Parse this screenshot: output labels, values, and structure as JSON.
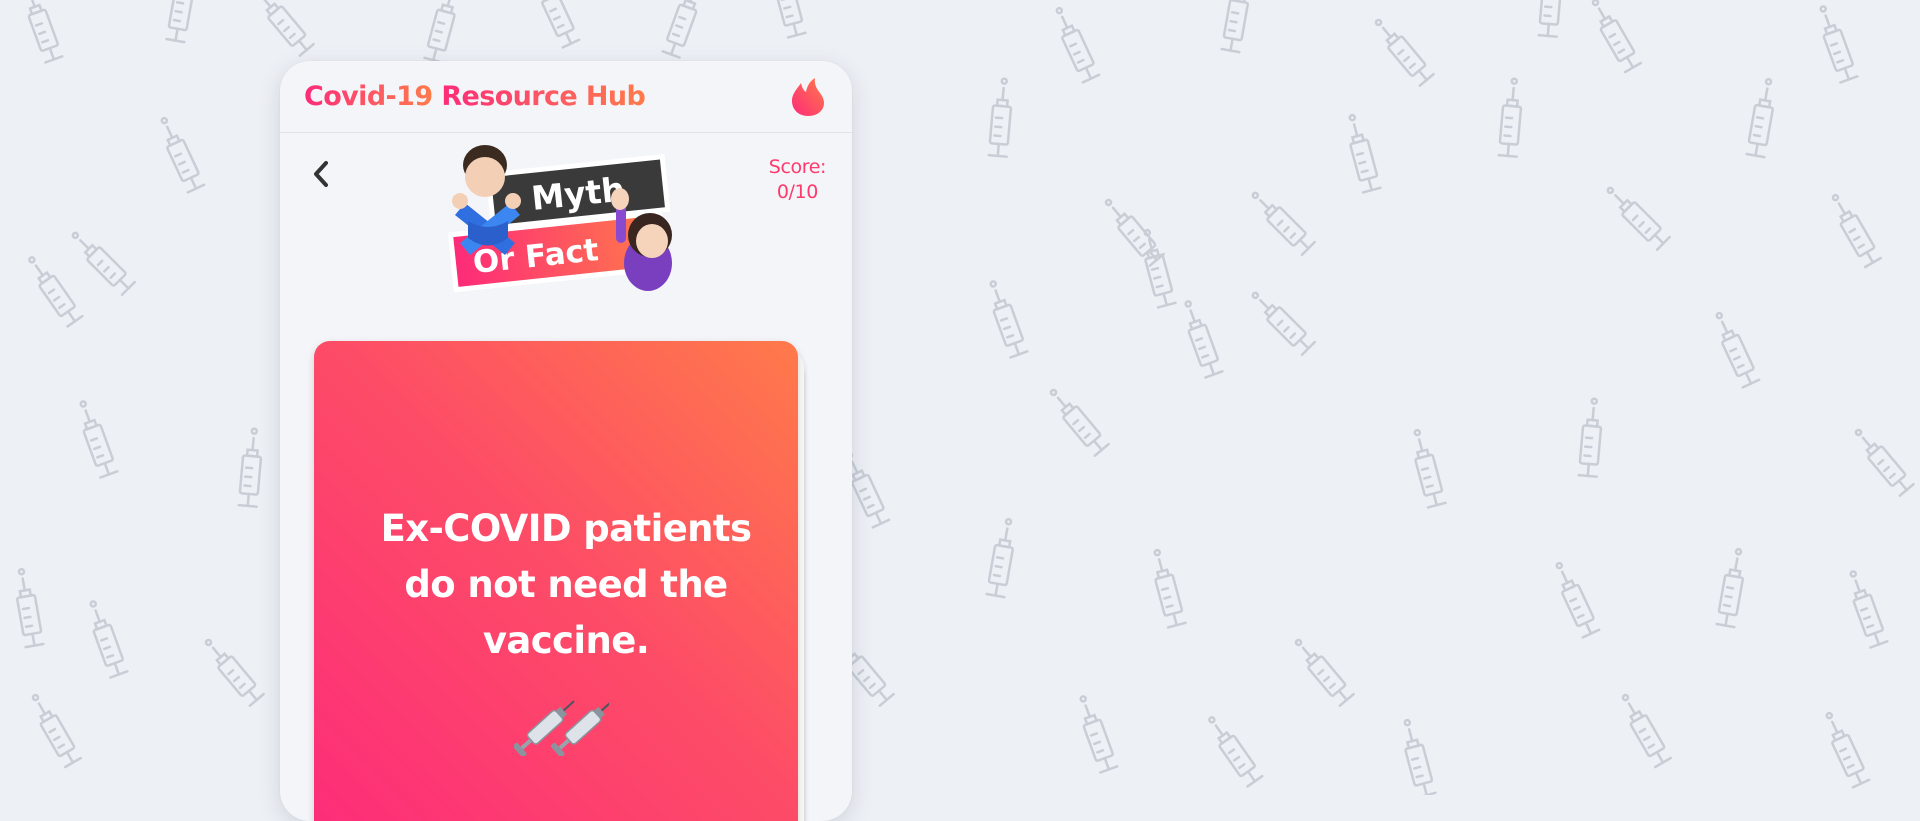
{
  "header": {
    "title_part1": "Covid-19",
    "title_part2": "Resource Hub",
    "icon": "flame-icon"
  },
  "game": {
    "back_icon": "chevron-left-icon",
    "logo_word1": "Myth",
    "logo_word2": "Or Fact",
    "score_label": "Score:",
    "score_value": "0/10"
  },
  "card": {
    "statement": "Ex-COVID patients do not need the vaccine.",
    "emoji": "syringe-icon"
  },
  "colors": {
    "accent_pink": "#fd2b78",
    "accent_orange": "#ff7a4a",
    "background": "#edf0f5"
  }
}
